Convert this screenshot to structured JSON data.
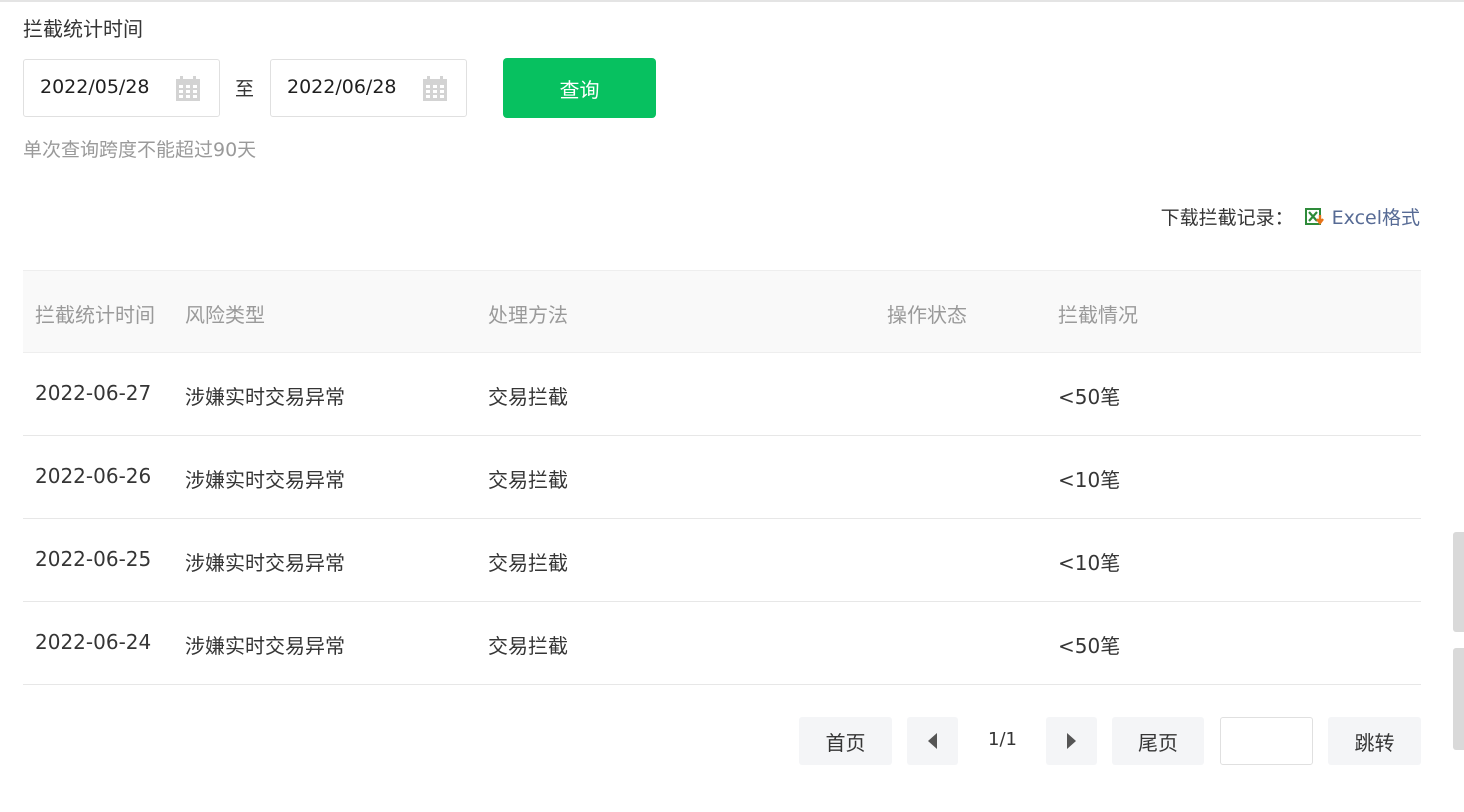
{
  "filter": {
    "label": "拦截统计时间",
    "start_date": "2022/05/28",
    "end_date": "2022/06/28",
    "separator": "至",
    "query_button": "查询",
    "hint": "单次查询跨度不能超过90天"
  },
  "download": {
    "label": "下载拦截记录：",
    "link": "Excel格式",
    "icon": "excel-icon"
  },
  "table": {
    "columns": [
      "拦截统计时间",
      "风险类型",
      "处理方法",
      "操作状态",
      "拦截情况"
    ],
    "rows": [
      {
        "date": "2022-06-27",
        "risk": "涉嫌实时交易异常",
        "method": "交易拦截",
        "status": "",
        "result": "<50笔"
      },
      {
        "date": "2022-06-26",
        "risk": "涉嫌实时交易异常",
        "method": "交易拦截",
        "status": "",
        "result": "<10笔"
      },
      {
        "date": "2022-06-25",
        "risk": "涉嫌实时交易异常",
        "method": "交易拦截",
        "status": "",
        "result": "<10笔"
      },
      {
        "date": "2022-06-24",
        "risk": "涉嫌实时交易异常",
        "method": "交易拦截",
        "status": "",
        "result": "<50笔"
      }
    ]
  },
  "pager": {
    "first": "首页",
    "last": "尾页",
    "page_info": "1/1",
    "jump_value": "",
    "go": "跳转"
  },
  "colors": {
    "primary_button": "#07c160",
    "link": "#576b95"
  }
}
